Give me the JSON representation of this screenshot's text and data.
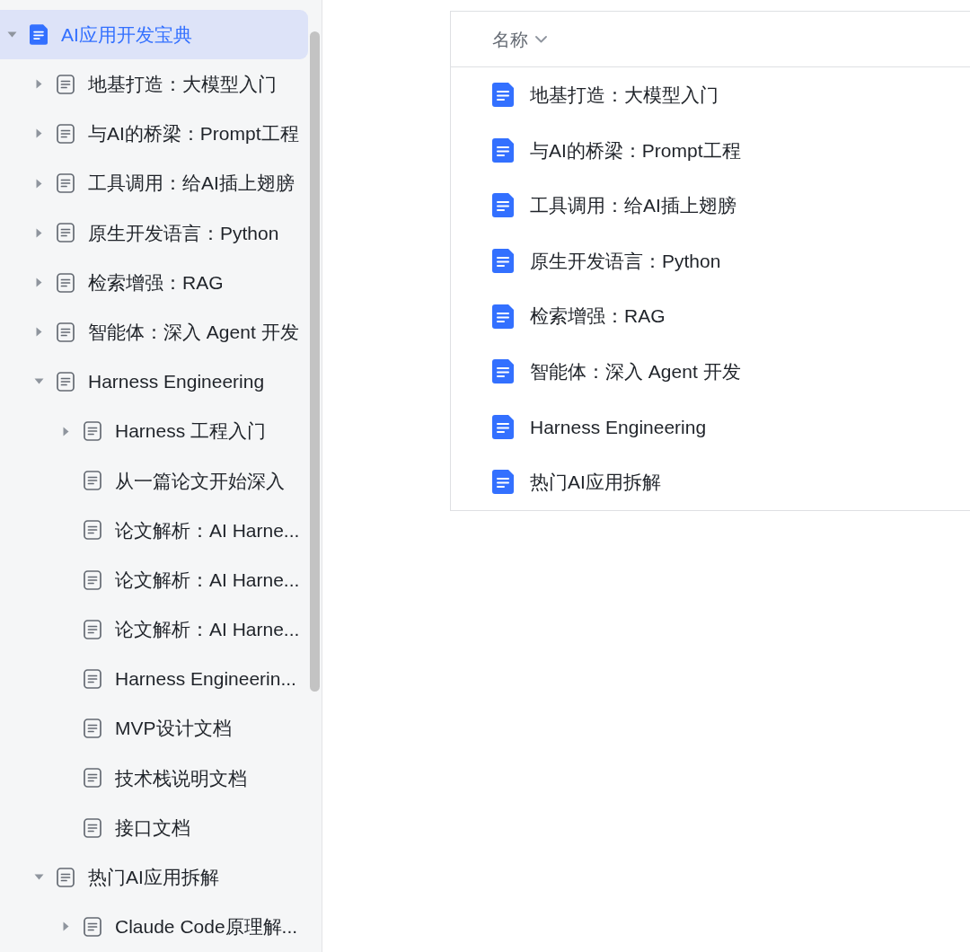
{
  "sidebar": {
    "tree": [
      {
        "title": "AI应用开发宝典",
        "selected": true,
        "expanded": true,
        "children": [
          {
            "title": "地基打造：大模型入门",
            "selected": false,
            "expanded": false
          },
          {
            "title": "与AI的桥梁：Prompt工程",
            "selected": false,
            "expanded": false
          },
          {
            "title": "工具调用：给AI插上翅膀",
            "selected": false,
            "expanded": false
          },
          {
            "title": "原生开发语言：Python",
            "selected": false,
            "expanded": false
          },
          {
            "title": "检索增强：RAG",
            "selected": false,
            "expanded": false
          },
          {
            "title": "智能体：深入 Agent 开发",
            "selected": false,
            "expanded": false
          },
          {
            "title": "Harness Engineering",
            "selected": false,
            "expanded": true,
            "children": [
              {
                "title": "Harness 工程入门",
                "selected": false,
                "expanded": false
              },
              {
                "title": "从一篇论文开始深入",
                "selected": false
              },
              {
                "title": "论文解析：AI Harne...",
                "selected": false
              },
              {
                "title": "论文解析：AI Harne...",
                "selected": false
              },
              {
                "title": "论文解析：AI Harne...",
                "selected": false
              },
              {
                "title": "Harness Engineerin...",
                "selected": false
              },
              {
                "title": "MVP设计文档",
                "selected": false
              },
              {
                "title": "技术栈说明文档",
                "selected": false
              },
              {
                "title": "接口文档",
                "selected": false
              }
            ]
          },
          {
            "title": "热门AI应用拆解",
            "selected": false,
            "expanded": true,
            "children": [
              {
                "title": "Claude Code原理解...",
                "selected": false,
                "expanded": false
              }
            ]
          }
        ]
      }
    ]
  },
  "table": {
    "columns": [
      {
        "label": "名称"
      }
    ],
    "rows": [
      {
        "name": "地基打造：大模型入门"
      },
      {
        "name": "与AI的桥梁：Prompt工程"
      },
      {
        "name": "工具调用：给AI插上翅膀"
      },
      {
        "name": "原生开发语言：Python"
      },
      {
        "name": "检索增强：RAG"
      },
      {
        "name": "智能体：深入 Agent 开发"
      },
      {
        "name": "Harness Engineering"
      },
      {
        "name": "热门AI应用拆解"
      }
    ]
  }
}
